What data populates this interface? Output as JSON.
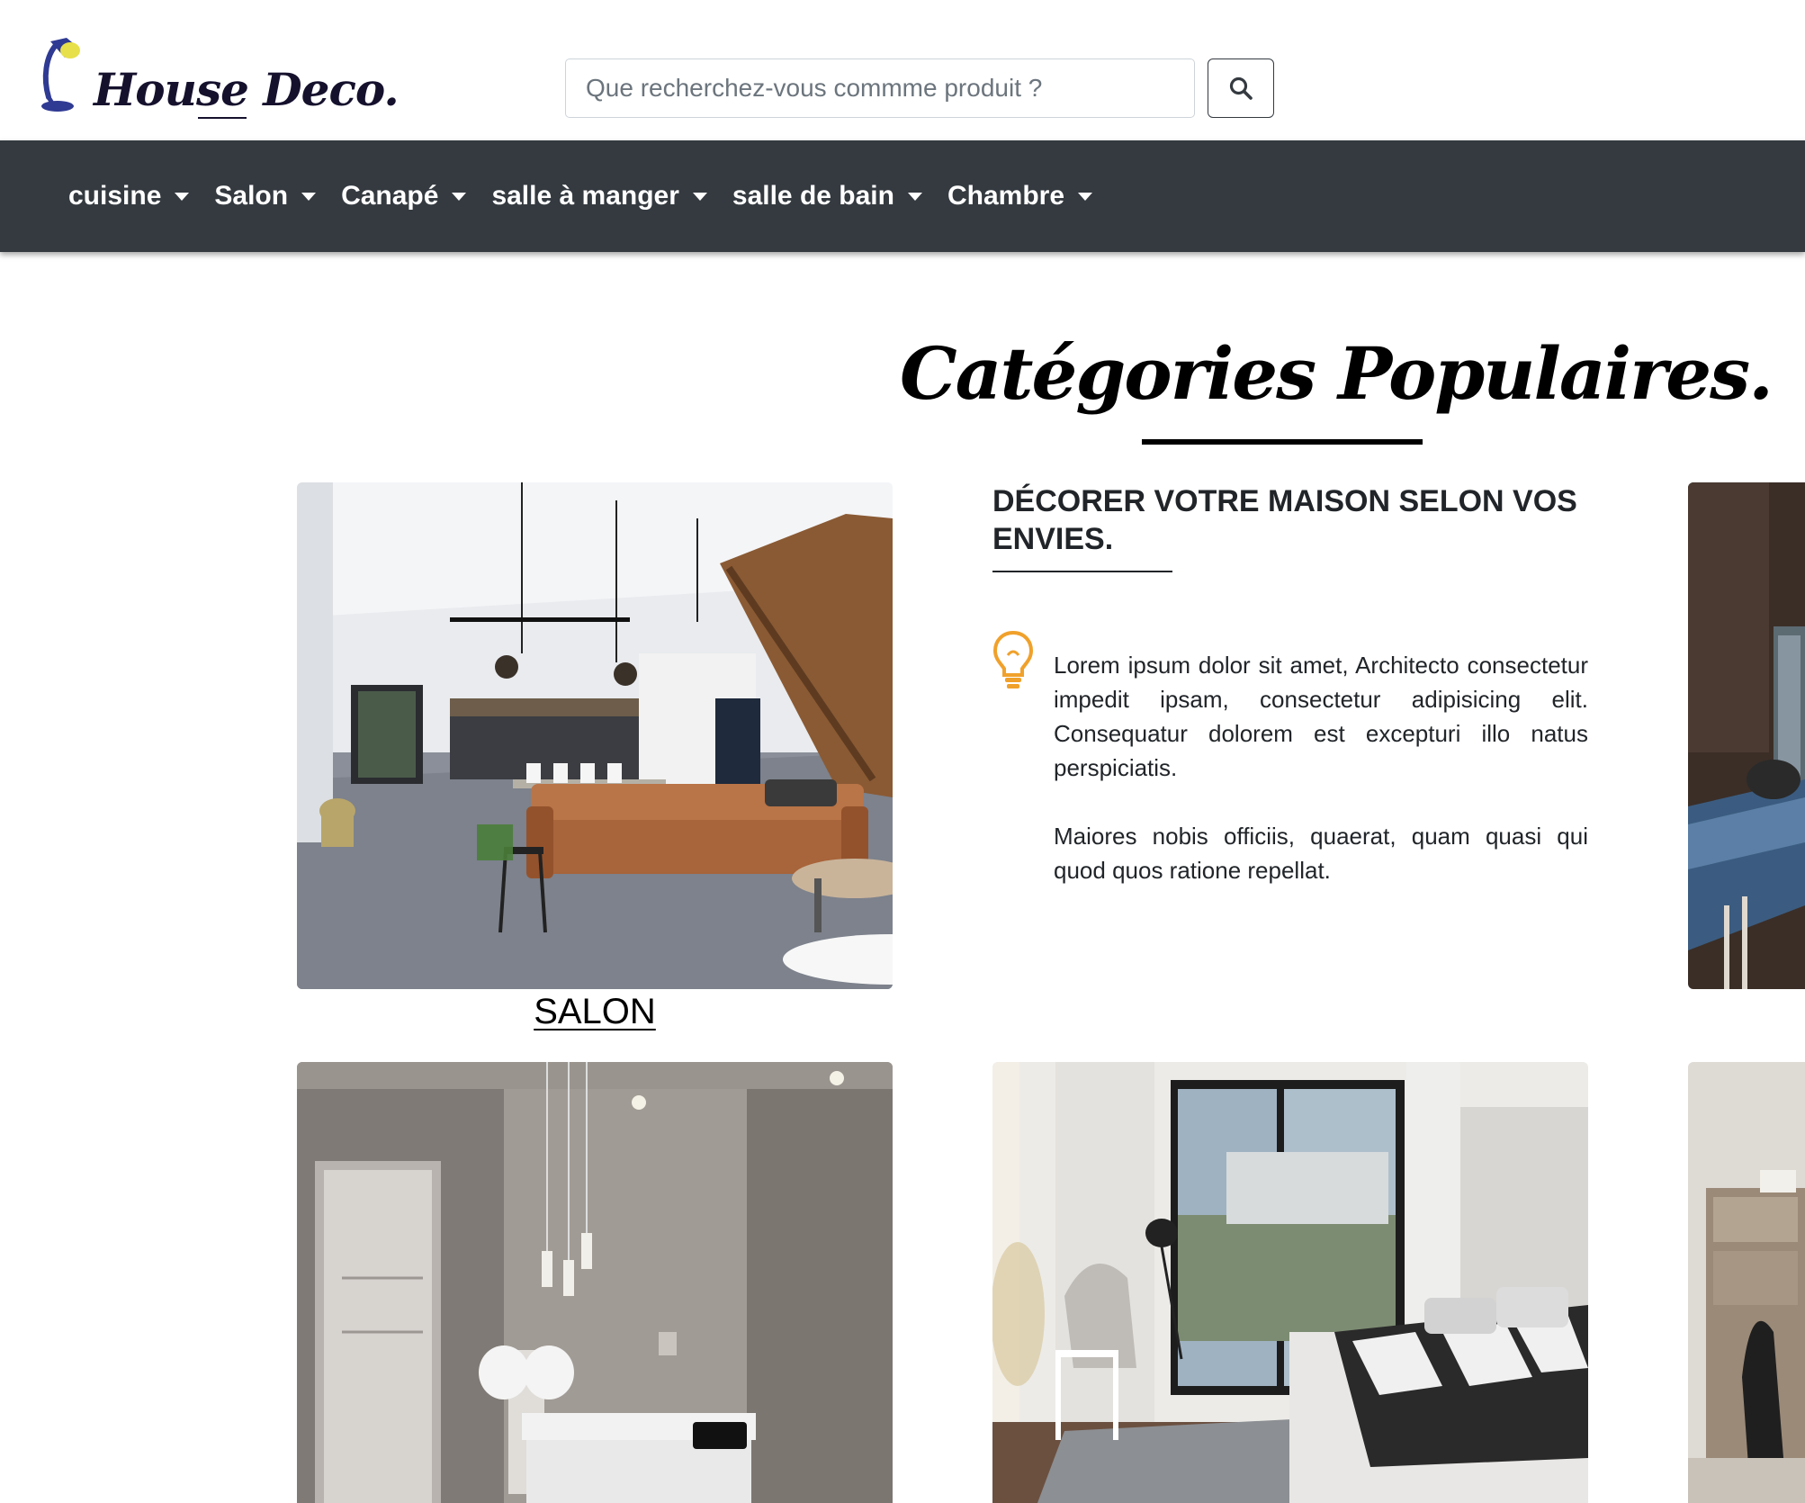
{
  "header": {
    "logo_text": "House Deco.",
    "search": {
      "placeholder": "Que recherchez-vous commme produit ?",
      "value": ""
    },
    "search_button_icon": "search-icon"
  },
  "nav": {
    "items": [
      {
        "label": "cuisine"
      },
      {
        "label": "Salon"
      },
      {
        "label": "Canapé"
      },
      {
        "label": "salle à manger"
      },
      {
        "label": "salle de bain"
      },
      {
        "label": "Chambre"
      }
    ],
    "dropdown_icon": "caret-down-icon"
  },
  "main": {
    "section_title": "Catégories Populaires.",
    "cards": [
      {
        "label": "SALON",
        "image": "living-room-photo"
      },
      {
        "label": "",
        "image": "kitchen-photo-partial"
      },
      {
        "label": "",
        "image": "entryway-photo"
      },
      {
        "label": "",
        "image": "bedroom-photo"
      },
      {
        "label": "",
        "image": "dining-photo-partial"
      }
    ],
    "feature": {
      "heading": "DÉCORER VOTRE MAISON SELON VOS ENVIES.",
      "icon": "lightbulb-icon",
      "paragraph_1": "Lorem ipsum dolor sit amet, Architecto consectetur impedit ipsam, consectetur adipisicing elit. Consequatur dolorem est excepturi illo natus perspiciatis.",
      "paragraph_2": "Maiores nobis officiis, quaerat, quam quasi qui quod quos ratione repellat."
    }
  },
  "colors": {
    "navbar_bg": "#343a40",
    "logo_blue": "#2f3a93",
    "bulb_orange": "#f0a12b",
    "text_dark": "#212529"
  }
}
